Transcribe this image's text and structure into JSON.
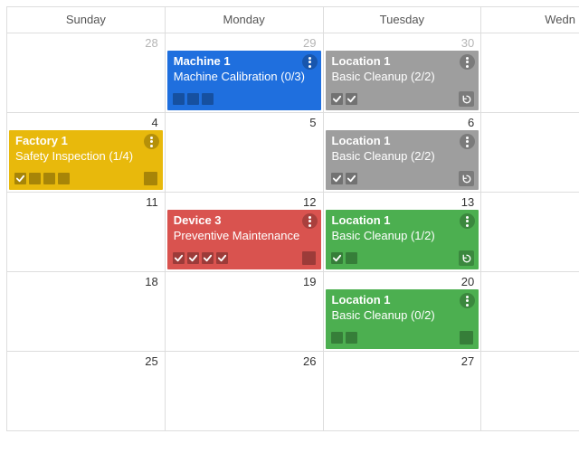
{
  "headers": [
    "Sunday",
    "Monday",
    "Tuesday",
    "Wedn"
  ],
  "weeks": [
    {
      "days": [
        {
          "num": 28,
          "muted": true,
          "event": null
        },
        {
          "num": 29,
          "muted": true,
          "event": {
            "color": "blue",
            "title": "Machine 1",
            "sub": "Machine Calibration (0/3)",
            "tasks": [
              false,
              false,
              false
            ],
            "kebab": true,
            "repeat": false,
            "trail_sq": false
          }
        },
        {
          "num": 30,
          "muted": true,
          "event": {
            "color": "gray",
            "title": "Location 1",
            "sub": "Basic Cleanup (2/2)",
            "tasks": [
              true,
              true
            ],
            "kebab": true,
            "repeat": true,
            "trail_sq": false
          }
        },
        {
          "num": "",
          "muted": false,
          "event": null
        }
      ]
    },
    {
      "days": [
        {
          "num": 4,
          "muted": false,
          "event": {
            "color": "yellow",
            "title": "Factory 1",
            "sub": "Safety Inspection (1/4)",
            "tasks": [
              true,
              false,
              false,
              false
            ],
            "kebab": true,
            "repeat": false,
            "trail_sq": true
          }
        },
        {
          "num": 5,
          "muted": false,
          "event": null
        },
        {
          "num": 6,
          "muted": false,
          "event": {
            "color": "gray",
            "title": "Location 1",
            "sub": "Basic Cleanup (2/2)",
            "tasks": [
              true,
              true
            ],
            "kebab": true,
            "repeat": true,
            "trail_sq": false
          }
        },
        {
          "num": "",
          "muted": false,
          "event": null
        }
      ]
    },
    {
      "days": [
        {
          "num": 11,
          "muted": false,
          "event": null
        },
        {
          "num": 12,
          "muted": false,
          "event": {
            "color": "red",
            "title": "Device 3",
            "sub": "Preventive Maintenance",
            "tasks": [
              true,
              true,
              true,
              true
            ],
            "kebab": true,
            "repeat": false,
            "trail_sq": true
          }
        },
        {
          "num": 13,
          "muted": false,
          "event": {
            "color": "green",
            "title": "Location 1",
            "sub": "Basic Cleanup (1/2)",
            "tasks": [
              true,
              false
            ],
            "kebab": true,
            "repeat": true,
            "trail_sq": false
          }
        },
        {
          "num": "",
          "muted": false,
          "event": null
        }
      ]
    },
    {
      "days": [
        {
          "num": 18,
          "muted": false,
          "event": null
        },
        {
          "num": 19,
          "muted": false,
          "event": null
        },
        {
          "num": 20,
          "muted": false,
          "event": {
            "color": "green",
            "title": "Location 1",
            "sub": "Basic Cleanup (0/2)",
            "tasks": [
              false,
              false
            ],
            "kebab": true,
            "repeat": false,
            "trail_sq": true
          }
        },
        {
          "num": "",
          "muted": false,
          "event": null
        }
      ]
    },
    {
      "days": [
        {
          "num": 25,
          "muted": false,
          "event": null
        },
        {
          "num": 26,
          "muted": false,
          "event": null
        },
        {
          "num": 27,
          "muted": false,
          "event": null
        },
        {
          "num": "",
          "muted": false,
          "event": null
        }
      ]
    }
  ]
}
